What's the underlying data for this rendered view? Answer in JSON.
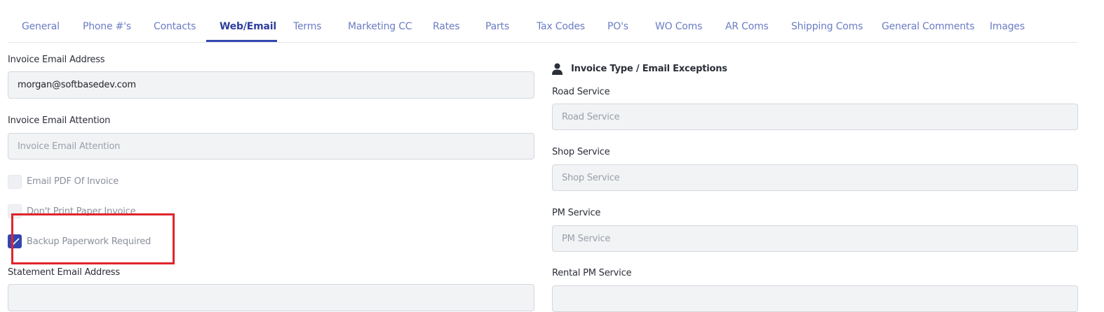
{
  "tabs": [
    {
      "label": "General"
    },
    {
      "label": "Phone #'s"
    },
    {
      "label": "Contacts"
    },
    {
      "label": "Web/Email",
      "active": true
    },
    {
      "label": "Terms"
    },
    {
      "label": "Marketing CC"
    },
    {
      "label": "Rates"
    },
    {
      "label": "Parts"
    },
    {
      "label": "Tax Codes"
    },
    {
      "label": "PO's"
    },
    {
      "label": "WO Coms"
    },
    {
      "label": "AR Coms"
    },
    {
      "label": "Shipping Coms"
    },
    {
      "label": "General Comments"
    },
    {
      "label": "Images"
    }
  ],
  "left": {
    "invoice_email_label": "Invoice Email Address",
    "invoice_email_value": "morgan@softbasedev.com",
    "invoice_attention_label": "Invoice Email Attention",
    "invoice_attention_placeholder": "Invoice Email Attention",
    "checkboxes": [
      {
        "label": "Email PDF Of Invoice",
        "checked": false
      },
      {
        "label": "Don't Print Paper Invoice",
        "checked": false
      },
      {
        "label": "Backup Paperwork Required",
        "checked": true
      }
    ],
    "statement_email_label": "Statement Email Address"
  },
  "right": {
    "section_title": "Invoice Type / Email Exceptions",
    "section_icon": "user-icon",
    "road_label": "Road Service",
    "road_placeholder": "Road Service",
    "shop_label": "Shop Service",
    "shop_placeholder": "Shop Service",
    "pm_label": "PM Service",
    "pm_placeholder": "PM Service",
    "rental_pm_label": "Rental PM Service"
  },
  "colors": {
    "accent": "#3346b0",
    "tab_text": "#6b7dc4",
    "highlight": "#e0252b"
  }
}
